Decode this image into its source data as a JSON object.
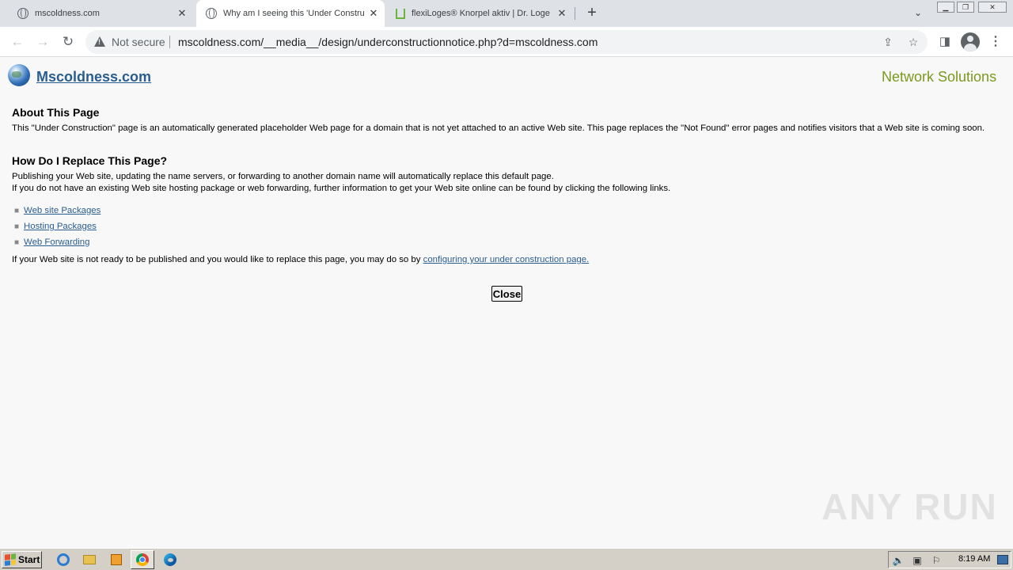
{
  "browser": {
    "tabs": [
      {
        "title": "mscoldness.com",
        "favicon": "globe-icon",
        "active": false
      },
      {
        "title": "Why am I seeing this 'Under Constru",
        "favicon": "globe-icon",
        "active": true
      },
      {
        "title": "flexiLoges® Knorpel aktiv | Dr. Loge",
        "favicon": "flexiloges-icon",
        "active": false
      }
    ],
    "new_tab_label": "+",
    "security_label": "Not secure",
    "url": "mscoldness.com/__media__/design/underconstructionnotice.php?d=mscoldness.com"
  },
  "page": {
    "site_name": "Mscoldness.com",
    "brand": "Network Solutions",
    "about_heading": "About This Page",
    "about_text": "This \"Under Construction\" page is an automatically generated placeholder Web page for a domain that is not yet attached to an active Web site. This page replaces the \"Not Found\" error pages and notifies visitors that a Web site is coming soon.",
    "replace_heading": "How Do I Replace This Page?",
    "replace_text_1": "Publishing your Web site, updating the name servers, or forwarding to another domain name will automatically replace this default page.",
    "replace_text_2": "If you do not have an existing Web site hosting package or web forwarding, further information to get your Web site online can be found by clicking the following links.",
    "links": [
      "Web site Packages",
      "Hosting Packages",
      "Web Forwarding"
    ],
    "configure_text": "If your Web site is not ready to be published and you would like to replace this page, you may do so by ",
    "configure_link": "configuring your under construction page.",
    "close_label": "Close",
    "watermark": "ANY RUN"
  },
  "taskbar": {
    "start_label": "Start",
    "clock": "8:19 AM"
  },
  "colors": {
    "link": "#2a5d8f",
    "brand": "#7a9a1e",
    "tab_strip": "#dee1e6"
  }
}
